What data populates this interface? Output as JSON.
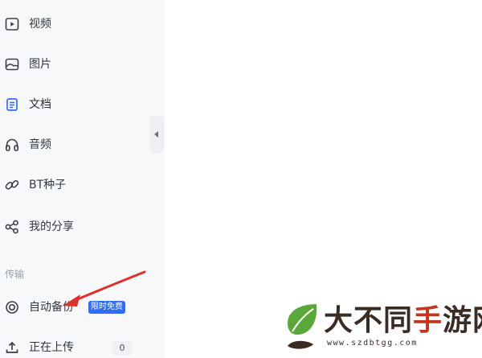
{
  "sidebar": {
    "items": [
      {
        "label": "视频",
        "icon": "video-icon"
      },
      {
        "label": "图片",
        "icon": "image-icon"
      },
      {
        "label": "文档",
        "icon": "document-icon",
        "active": true
      },
      {
        "label": "音频",
        "icon": "headphones-icon"
      },
      {
        "label": "BT种子",
        "icon": "link-icon"
      },
      {
        "label": "我的分享",
        "icon": "share-icon"
      }
    ],
    "section_title": "传输",
    "transfer_items": [
      {
        "label": "自动备份",
        "icon": "backup-icon",
        "badge": "限时免费"
      },
      {
        "label": "正在上传",
        "icon": "upload-icon",
        "count": "0"
      }
    ]
  },
  "colors": {
    "accent": "#2f6bff",
    "active_icon": "#2f6bff",
    "annotation_arrow": "#e0302a"
  },
  "watermark": {
    "text": "大不同手游网",
    "url": "www.szdbtgg.com"
  }
}
